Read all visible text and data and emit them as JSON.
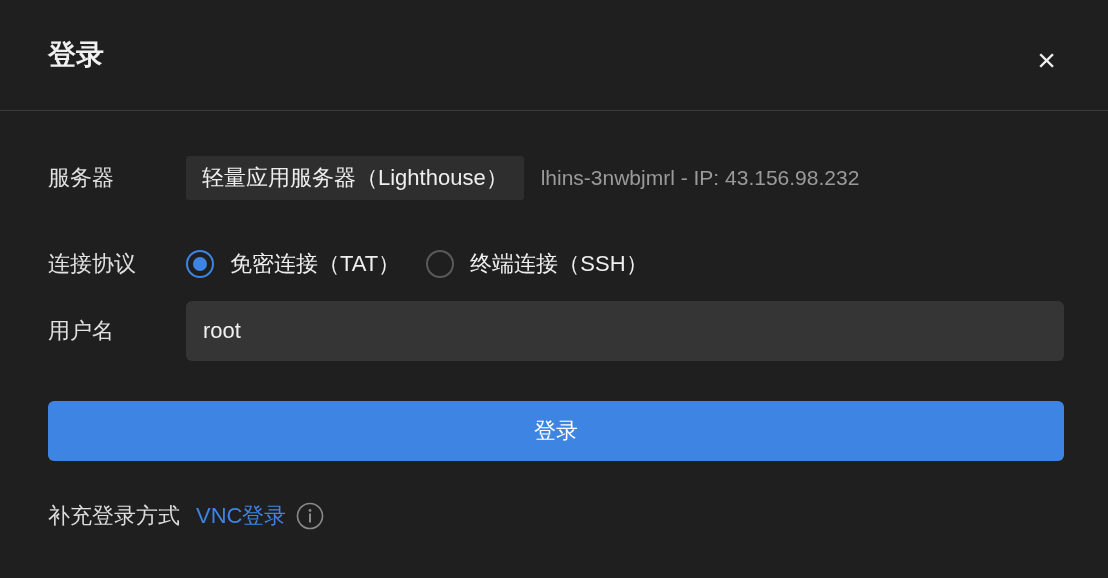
{
  "dialog": {
    "title": "登录",
    "close": "×"
  },
  "server": {
    "label": "服务器",
    "type": "轻量应用服务器（Lighthouse）",
    "detail": "lhins-3nwbjmrl - IP: 43.156.98.232"
  },
  "protocol": {
    "label": "连接协议",
    "options": [
      {
        "label": "免密连接（TAT）",
        "selected": true
      },
      {
        "label": "终端连接（SSH）",
        "selected": false
      }
    ]
  },
  "username": {
    "label": "用户名",
    "value": "root"
  },
  "submit": "登录",
  "footer": {
    "text": "补充登录方式",
    "link": "VNC登录"
  }
}
